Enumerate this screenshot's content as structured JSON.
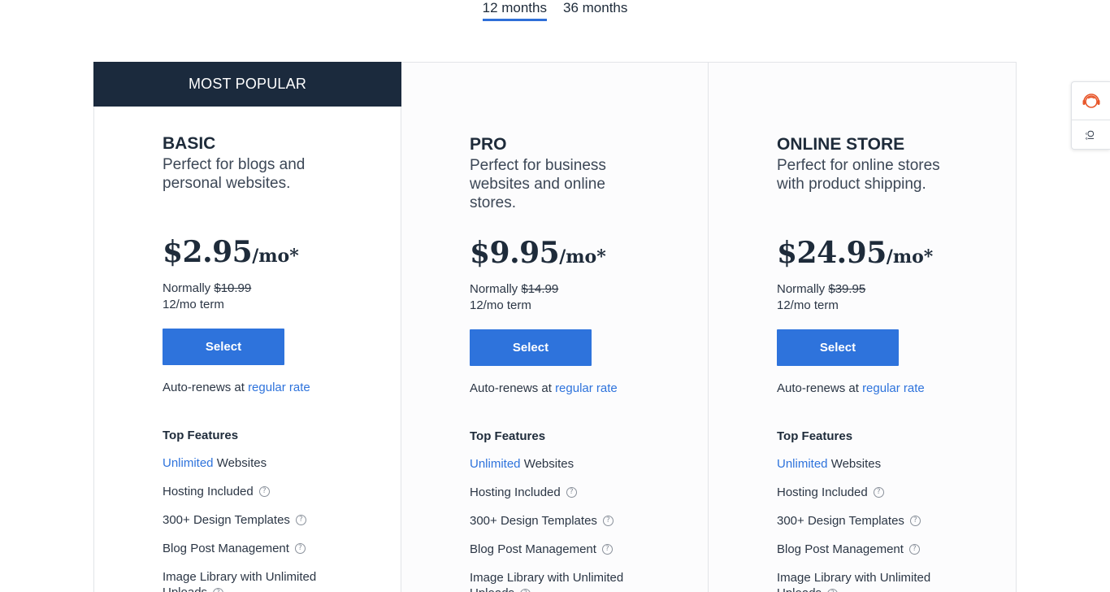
{
  "tabs": [
    {
      "label": "12 months",
      "active": true
    },
    {
      "label": "36 months",
      "active": false
    }
  ],
  "banner": "MOST POPULAR",
  "plans": [
    {
      "name": "BASIC",
      "desc": "Perfect for blogs and personal websites.",
      "price": "$2.95",
      "per": "/mo*",
      "normally_label": "Normally",
      "normally_price": "$10.99",
      "term": "12/mo term",
      "select_label": "Select",
      "renew_text": "Auto-renews at",
      "renew_link": "regular rate",
      "features_title": "Top Features",
      "features": {
        "f1_link": "Unlimited",
        "f1_text": "Websites",
        "f2": "Hosting Included",
        "f3": "300+ Design Templates",
        "f4": "Blog Post Management",
        "f5": "Image Library with Unlimited Uploads"
      }
    },
    {
      "name": "PRO",
      "desc": "Perfect for business websites and online stores.",
      "price": "$9.95",
      "per": "/mo*",
      "normally_label": "Normally",
      "normally_price": "$14.99",
      "term": "12/mo term",
      "select_label": "Select",
      "renew_text": "Auto-renews at",
      "renew_link": "regular rate",
      "features_title": "Top Features",
      "features": {
        "f1_link": "Unlimited",
        "f1_text": "Websites",
        "f2": "Hosting Included",
        "f3": "300+ Design Templates",
        "f4": "Blog Post Management",
        "f5": "Image Library with Unlimited Uploads"
      }
    },
    {
      "name": "ONLINE STORE",
      "desc": "Perfect for online stores with product shipping.",
      "price": "$24.95",
      "per": "/mo*",
      "normally_label": "Normally",
      "normally_price": "$39.95",
      "term": "12/mo term",
      "select_label": "Select",
      "renew_text": "Auto-renews at",
      "renew_link": "regular rate",
      "features_title": "Top Features",
      "features": {
        "f1_link": "Unlimited",
        "f1_text": "Websites",
        "f2": "Hosting Included",
        "f3": "300+ Design Templates",
        "f4": "Blog Post Management",
        "f5": "Image Library with Unlimited Uploads"
      }
    }
  ],
  "help_glyph": "?",
  "side_widget": {
    "icon": "headset-icon",
    "label": "ÎÔ"
  },
  "colors": {
    "accent": "#2e73dc",
    "banner_bg": "#1b2a3d",
    "headset": "#e8562a"
  }
}
